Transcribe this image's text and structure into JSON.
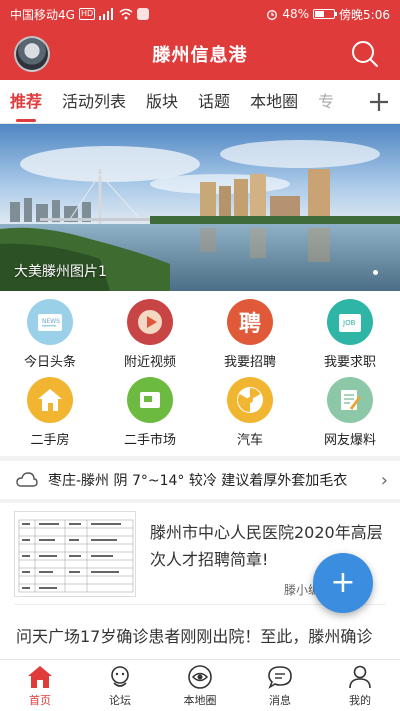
{
  "status_bar": {
    "carrier": "中国移动4G",
    "hd": "HD",
    "net": "4G",
    "battery": "48%",
    "battery_level": 0.48,
    "time": "傍晚5:06"
  },
  "header": {
    "title": "滕州信息港"
  },
  "tabs": [
    {
      "label": "推荐",
      "active": true
    },
    {
      "label": "活动列表"
    },
    {
      "label": "版块"
    },
    {
      "label": "话题"
    },
    {
      "label": "本地圈"
    },
    {
      "label": "专"
    }
  ],
  "banner": {
    "caption": "大美滕州图片1"
  },
  "grid": [
    {
      "label": "今日头条",
      "icon": "news-icon",
      "color": "#9ad0e8"
    },
    {
      "label": "附近视频",
      "icon": "play-icon",
      "color": "#c94545"
    },
    {
      "label": "我要招聘",
      "icon": "hire-icon",
      "color": "#e05a3a"
    },
    {
      "label": "我要求职",
      "icon": "job-icon",
      "color": "#2fb5a6"
    },
    {
      "label": "二手房",
      "icon": "house-icon",
      "color": "#f2b531"
    },
    {
      "label": "二手市场",
      "icon": "market-icon",
      "color": "#6cba3f"
    },
    {
      "label": "汽车",
      "icon": "car-icon",
      "color": "#f2b531"
    },
    {
      "label": "网友爆料",
      "icon": "report-icon",
      "color": "#8cc7a8"
    }
  ],
  "weather": {
    "text": "枣庄-滕州 阴 7°~14° 较冷 建议着厚外套加毛衣"
  },
  "news": [
    {
      "title": "滕州市中心人民医院2020年高层次人才招聘简章!",
      "source": "滕小编"
    },
    {
      "title": "问天广场17岁确诊患者刚刚出院！至此，滕州确诊"
    }
  ],
  "fab": {
    "label": "+"
  },
  "bottom_nav": [
    {
      "label": "首页",
      "active": true
    },
    {
      "label": "论坛"
    },
    {
      "label": "本地圈"
    },
    {
      "label": "消息"
    },
    {
      "label": "我的"
    }
  ],
  "colors": {
    "brand": "#e03b3b",
    "fab": "#3b8de0"
  }
}
